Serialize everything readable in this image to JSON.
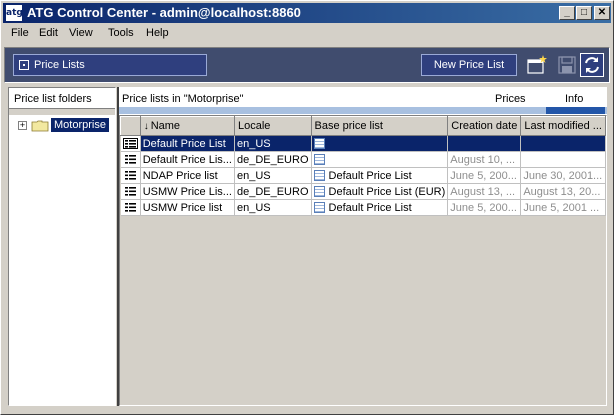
{
  "window": {
    "app_icon_text": "atg",
    "title": "ATG Control Center - admin@localhost:8860",
    "controls": {
      "minimize": "_",
      "maximize": "□",
      "close": "✕"
    }
  },
  "menu": [
    {
      "label": "File"
    },
    {
      "label": "Edit"
    },
    {
      "label": "View"
    },
    {
      "label": "Tools"
    },
    {
      "label": "Help"
    }
  ],
  "toolbar": {
    "section_label": "Price Lists",
    "new_button_label": "New Price List",
    "icons": [
      "new-window-icon",
      "save-icon",
      "refresh-icon"
    ]
  },
  "left_panel": {
    "header": "Price list folders",
    "tree": {
      "expander": "+",
      "node_label": "Motorprise"
    }
  },
  "right_panel": {
    "header": "Price lists in \"Motorprise\"",
    "tabs": [
      {
        "label": "Prices"
      },
      {
        "label": "Info",
        "selected": true
      }
    ]
  },
  "table": {
    "sort_indicator": "↓",
    "columns": [
      "",
      "Name",
      "Locale",
      "Base price list",
      "Creation date",
      "Last modified ..."
    ],
    "rows": [
      {
        "name": "Default Price List",
        "locale": "en_US",
        "base": "",
        "created": "",
        "modified": "",
        "selected": true
      },
      {
        "name": "Default Price Lis...",
        "locale": "de_DE_EURO",
        "base": "",
        "created": "August 10, ...",
        "modified": ""
      },
      {
        "name": "NDAP Price list",
        "locale": "en_US",
        "base": "Default Price List",
        "created": "June 5, 200...",
        "modified": "June 30, 2001..."
      },
      {
        "name": "USMW Price Lis...",
        "locale": "de_DE_EURO",
        "base": "Default Price List (EUR)",
        "created": "August 13, ...",
        "modified": "August 13, 20..."
      },
      {
        "name": "USMW Price list",
        "locale": "en_US",
        "base": "Default Price List",
        "created": "June 5, 200...",
        "modified": "June 5, 2001 ..."
      }
    ]
  },
  "colors": {
    "title_gradient_start": "#0a246a",
    "title_gradient_end": "#3a6ea5",
    "toolbar_bg": "#404c6e",
    "selection": "#0a246a",
    "tab_selected": "#2356a8"
  }
}
